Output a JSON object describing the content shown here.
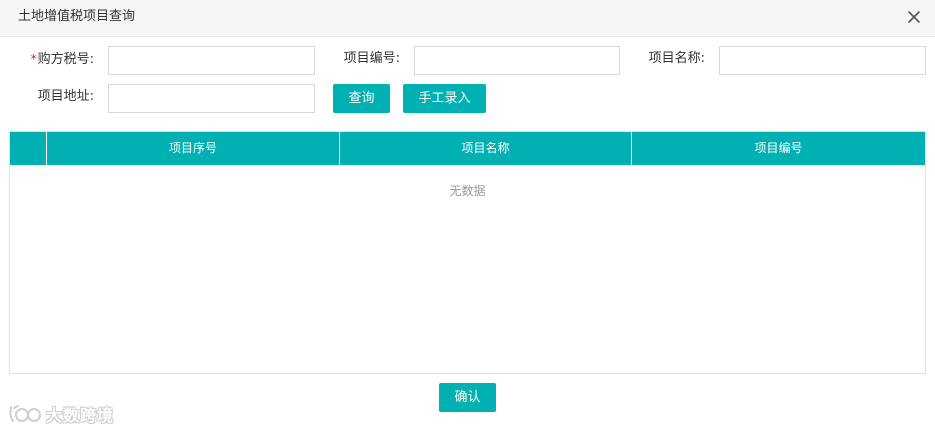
{
  "dialog": {
    "title": "土地增值税项目查询",
    "close_icon": "close-icon"
  },
  "form": {
    "required_mark": "*",
    "buyer_tax_id_label": "购方税号:",
    "buyer_tax_id_value": "",
    "project_code_label": "项目编号:",
    "project_code_value": "",
    "project_name_label": "项目名称:",
    "project_name_value": "",
    "project_address_label": "项目地址:",
    "project_address_value": ""
  },
  "buttons": {
    "query": "查询",
    "manual_entry": "手工录入",
    "confirm": "确认"
  },
  "table": {
    "columns": [
      "",
      "项目序号",
      "项目名称",
      "项目编号"
    ],
    "rows": [],
    "empty_text": "无数据"
  },
  "watermark": {
    "text": "大数跨境"
  },
  "colors": {
    "accent": "#00b0b2",
    "required": "#e02020"
  }
}
